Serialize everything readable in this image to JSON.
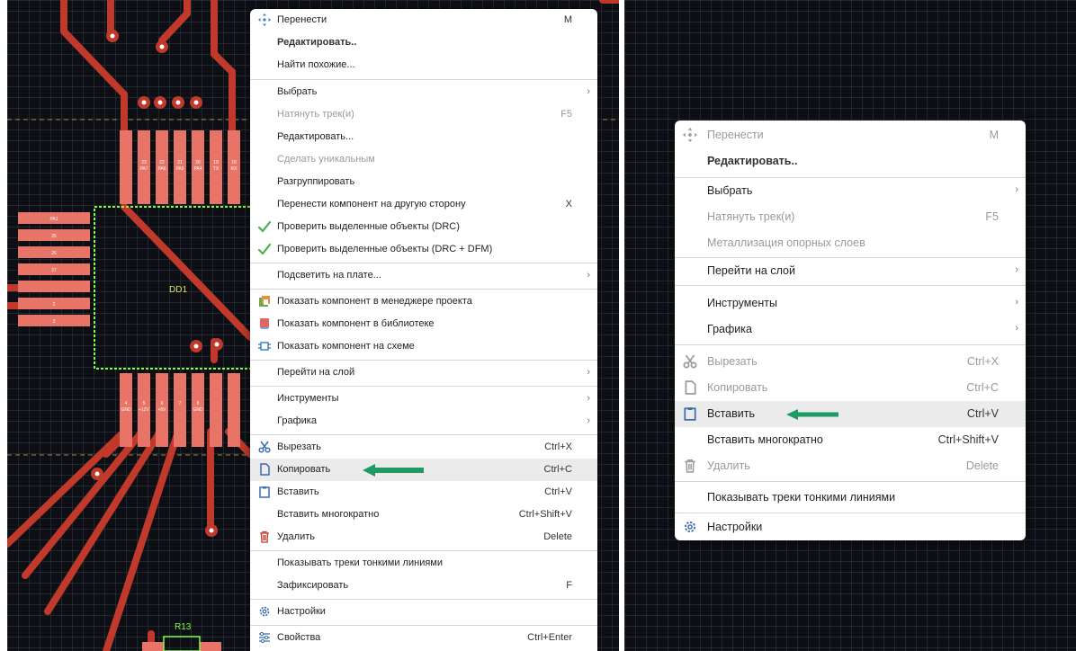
{
  "left_menu": {
    "items": [
      {
        "label": "Перенести",
        "shortcut": "M"
      },
      {
        "label": "Редактировать.."
      },
      {
        "label": "Найти похожие..."
      },
      {
        "label": "Выбрать"
      },
      {
        "label": "Натянуть трек(и)",
        "shortcut": "F5"
      },
      {
        "label": "Редактировать..."
      },
      {
        "label": "Сделать уникальным"
      },
      {
        "label": "Разгруппировать"
      },
      {
        "label": "Перенести компонент на другую сторону",
        "shortcut": "X"
      },
      {
        "label": "Проверить выделенные объекты (DRC)"
      },
      {
        "label": "Проверить выделенные объекты (DRC + DFM)"
      },
      {
        "label": "Подсветить на плате..."
      },
      {
        "label": "Показать компонент в менеджере проекта"
      },
      {
        "label": "Показать компонент в библиотеке"
      },
      {
        "label": "Показать компонент на схеме"
      },
      {
        "label": "Перейти на слой"
      },
      {
        "label": "Инструменты"
      },
      {
        "label": "Графика"
      },
      {
        "label": "Вырезать",
        "shortcut": "Ctrl+X"
      },
      {
        "label": "Копировать",
        "shortcut": "Ctrl+C"
      },
      {
        "label": "Вставить",
        "shortcut": "Ctrl+V"
      },
      {
        "label": "Вставить многократно",
        "shortcut": "Ctrl+Shift+V"
      },
      {
        "label": "Удалить",
        "shortcut": "Delete"
      },
      {
        "label": "Показывать треки тонкими линиями"
      },
      {
        "label": "Зафиксировать",
        "shortcut": "F"
      },
      {
        "label": "Настройки"
      },
      {
        "label": "Свойства",
        "shortcut": "Ctrl+Enter"
      }
    ]
  },
  "right_menu": {
    "items": [
      {
        "label": "Перенести",
        "shortcut": "M"
      },
      {
        "label": "Редактировать.."
      },
      {
        "label": "Выбрать"
      },
      {
        "label": "Натянуть трек(и)",
        "shortcut": "F5"
      },
      {
        "label": "Металлизация опорных слоев"
      },
      {
        "label": "Перейти на слой"
      },
      {
        "label": "Инструменты"
      },
      {
        "label": "Графика"
      },
      {
        "label": "Вырезать",
        "shortcut": "Ctrl+X"
      },
      {
        "label": "Копировать",
        "shortcut": "Ctrl+C"
      },
      {
        "label": "Вставить",
        "shortcut": "Ctrl+V"
      },
      {
        "label": "Вставить многократно",
        "shortcut": "Ctrl+Shift+V"
      },
      {
        "label": "Удалить",
        "shortcut": "Delete"
      },
      {
        "label": "Показывать треки тонкими линиями"
      },
      {
        "label": "Настройки"
      }
    ]
  },
  "pcb": {
    "component_ref": "DD1",
    "resistor_ref": "R13",
    "top_pin_numbers": [
      "23",
      "22",
      "21",
      "20",
      "19",
      "18"
    ],
    "top_pin_nets": [
      "PA7",
      "PA6",
      "PA5",
      "PA4",
      "TX",
      "RX"
    ],
    "left_pin_labels": [
      "PA1",
      "25",
      "26",
      "27",
      "",
      "2",
      "3"
    ],
    "bottom_pin_numbers": [
      "4",
      "5",
      "6",
      "7",
      "8"
    ],
    "bottom_pin_nets": [
      "GND",
      "+12V",
      "+5V",
      "",
      "GND"
    ]
  },
  "colors": {
    "pad": "#e87467",
    "track": "#c0392b",
    "outline": "#7fff3f",
    "arrow": "#1e9a63",
    "check": "#4caf50",
    "background": "#0d0f14"
  }
}
